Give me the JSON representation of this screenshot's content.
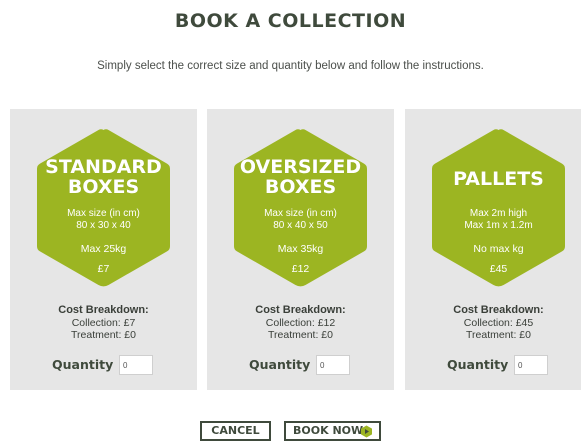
{
  "header": {
    "title": "BOOK A COLLECTION",
    "subtitle": "Simply select the correct size and quantity below and follow the instructions."
  },
  "colors": {
    "hex_green": "#9cb522",
    "card_bg": "#e6e6e6",
    "text_dark": "#3f4a3c"
  },
  "cards": [
    {
      "title_line1": "STANDARD",
      "title_line2": "BOXES",
      "detail1": "Max size (in cm)",
      "detail2": "80 x 30 x 40",
      "weight": "Max 25kg",
      "price": "£7",
      "cost_heading": "Cost Breakdown:",
      "collection": "Collection: £7",
      "treatment": "Treatment: £0",
      "quantity_label": "Quantity",
      "quantity_value": "0"
    },
    {
      "title_line1": "OVERSIZED",
      "title_line2": "BOXES",
      "detail1": "Max size (in cm)",
      "detail2": "80 x 40 x 50",
      "weight": "Max 35kg",
      "price": "£12",
      "cost_heading": "Cost Breakdown:",
      "collection": "Collection: £12",
      "treatment": "Treatment: £0",
      "quantity_label": "Quantity",
      "quantity_value": "0"
    },
    {
      "title_line1": "PALLETS",
      "title_line2": "",
      "detail1": "Max 2m high",
      "detail2": "Max 1m x 1.2m",
      "weight": "No max kg",
      "price": "£45",
      "cost_heading": "Cost Breakdown:",
      "collection": "Collection: £45",
      "treatment": "Treatment: £0",
      "quantity_label": "Quantity",
      "quantity_value": "0"
    }
  ],
  "buttons": {
    "cancel": "CANCEL",
    "book_now": "BOOK NOW",
    "book_now_icon": "play-icon"
  }
}
